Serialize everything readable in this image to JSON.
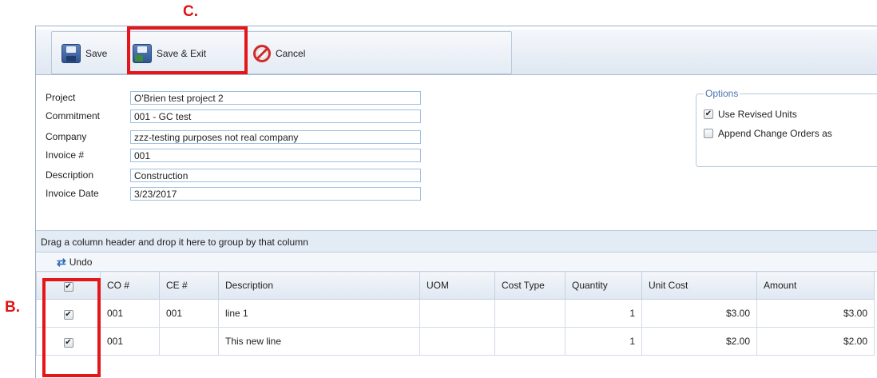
{
  "callouts": {
    "c": "C.",
    "b": "B."
  },
  "toolbar": {
    "save_label": "Save",
    "save_exit_label": "Save & Exit",
    "cancel_label": "Cancel"
  },
  "form": {
    "project": {
      "label": "Project",
      "value": "O'Brien test project 2"
    },
    "commitment": {
      "label": "Commitment",
      "value": "001 - GC test"
    },
    "company": {
      "label": "Company",
      "value": "zzz-testing purposes not real company"
    },
    "invoice_no": {
      "label": "Invoice #",
      "value": "001"
    },
    "description": {
      "label": "Description",
      "value": "Construction"
    },
    "invoice_date": {
      "label": "Invoice Date",
      "value": "3/23/2017"
    }
  },
  "options": {
    "legend": "Options",
    "use_revised_units": {
      "label": "Use Revised Units",
      "checked": true
    },
    "append_change_orders": {
      "label": "Append Change Orders as",
      "checked": false
    }
  },
  "grid": {
    "group_hint": "Drag a column header and drop it here to group by that column",
    "undo_label": "Undo",
    "header_check": "✔",
    "columns": [
      "CO #",
      "CE #",
      "Description",
      "UOM",
      "Cost Type",
      "Quantity",
      "Unit Cost",
      "Amount"
    ],
    "rows": [
      {
        "check": "✔",
        "co": "001",
        "ce": "001",
        "description": "line 1",
        "uom": "",
        "cost_type": "",
        "quantity": "1",
        "unit_cost": "$3.00",
        "amount": "$3.00"
      },
      {
        "check": "✔",
        "co": "001",
        "ce": "",
        "description": "This new line",
        "uom": "",
        "cost_type": "",
        "quantity": "1",
        "unit_cost": "$2.00",
        "amount": "$2.00"
      }
    ]
  },
  "colors": {
    "highlight": "#e4161a",
    "accent": "#4a73b0"
  }
}
